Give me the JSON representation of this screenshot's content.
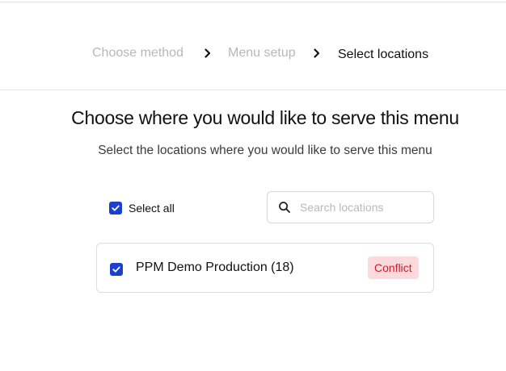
{
  "stepper": {
    "steps": [
      {
        "label": "Choose method",
        "state": "completed"
      },
      {
        "label": "Menu setup",
        "state": "completed"
      },
      {
        "label": "Select locations",
        "state": "current"
      }
    ],
    "separator_icon": "chevron-right-icon"
  },
  "main": {
    "title": "Choose where you would like to serve this menu",
    "subtitle": "Select the locations where you would like to serve this menu",
    "select_all": {
      "label": "Select all",
      "checked": true
    },
    "search": {
      "placeholder": "Search locations",
      "value": "",
      "icon": "search-icon"
    },
    "locations": [
      {
        "name": "PPM Demo Production (18)",
        "checked": true,
        "badge": "Conflict"
      }
    ]
  },
  "colors": {
    "accent": "#1b3fcf",
    "inactive_step": "#b8b8b8",
    "conflict_text": "#c8202f",
    "conflict_bg": "#fbd9dc"
  }
}
